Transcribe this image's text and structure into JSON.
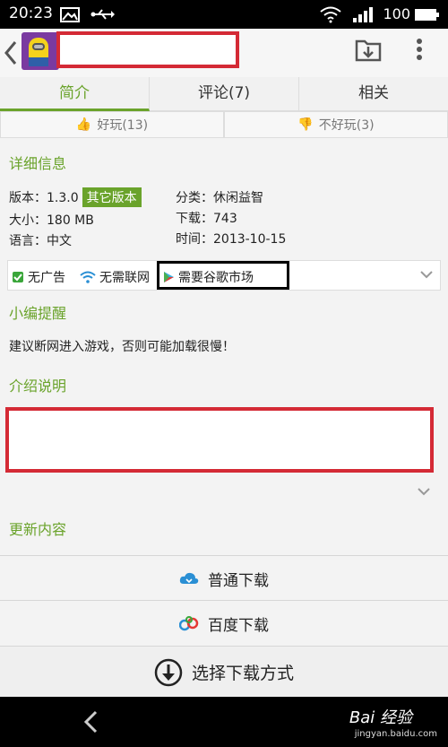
{
  "status": {
    "time": "20:23",
    "battery": "100"
  },
  "tabs": [
    {
      "label": "简介",
      "active": true
    },
    {
      "label": "评论(7)",
      "active": false
    },
    {
      "label": "相关",
      "active": false
    }
  ],
  "rating": {
    "good": "好玩(13)",
    "bad": "不好玩(3)"
  },
  "details": {
    "title": "详细信息",
    "version_label": "版本：1.3.0",
    "other_version": "其它版本",
    "size": "大小：180 MB",
    "language": "语言：中文",
    "category": "分类：休闲益智",
    "downloads": "下载：743",
    "date": "时间：2013-10-15"
  },
  "features": {
    "no_ads": "无广告",
    "no_network": "无需联网",
    "google_market": "需要谷歌市场"
  },
  "editor": {
    "title": "小编提醒",
    "text": "建议断网进入游戏，否则可能加载很慢！"
  },
  "intro": {
    "title": "介绍说明"
  },
  "update": {
    "title": "更新内容"
  },
  "downloads": {
    "normal": "普通下载",
    "baidu": "百度下载",
    "choose": "选择下载方式"
  },
  "watermark": {
    "brand": "Bai 经验",
    "url": "jingyan.baidu.com"
  },
  "colors": {
    "accent": "#6aa32b",
    "redact": "#d42a35"
  }
}
